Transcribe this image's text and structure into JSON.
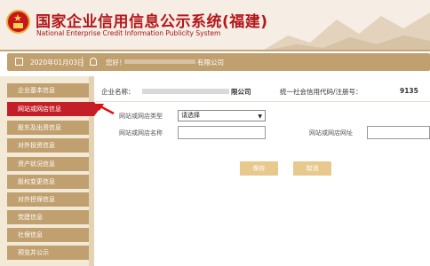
{
  "header": {
    "title_cn": "国家企业信用信息公示系统(福建)",
    "title_en": "National Enterprise Credit Information Publicity System"
  },
  "infobar": {
    "date": "2020年01月03日",
    "greeting": "您好！",
    "company_suffix": "有限公司"
  },
  "sidebar": {
    "items": [
      {
        "label": "企业基本信息"
      },
      {
        "label": "网站或网店信息",
        "active": true
      },
      {
        "label": "股东及出资信息"
      },
      {
        "label": "对外投资信息"
      },
      {
        "label": "资产状况信息"
      },
      {
        "label": "股权变更信息"
      },
      {
        "label": "对外担保信息"
      },
      {
        "label": "党建信息"
      },
      {
        "label": "社保信息"
      },
      {
        "label": "预览并公示"
      }
    ]
  },
  "main": {
    "company_label": "企业名称：",
    "company_name_suffix": "限公司",
    "credit_code_label": "统一社会信用代码/注册号：",
    "credit_code_prefix": "9135",
    "form": {
      "type_label": "网站或网店类型",
      "type_value": "请选择",
      "name_label": "网站或网店名称",
      "url_label": "网站或网店网址"
    },
    "save_label": "保存",
    "cancel_label": "取消"
  },
  "colors": {
    "brand_red": "#c41f28",
    "nav_tan": "#c1a06f",
    "button_gold": "#e7c98e"
  }
}
